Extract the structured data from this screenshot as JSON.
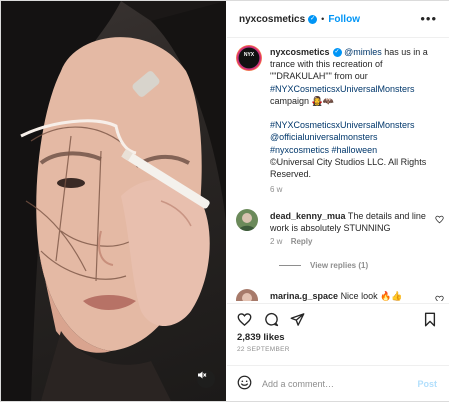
{
  "header": {
    "username": "nyxcosmetics",
    "follow_label": "Follow",
    "separator": "•",
    "more_label": "•••"
  },
  "avatar_logo": "NYX",
  "caption": {
    "username": "nyxcosmetics",
    "mention": "@mimles",
    "text_1": " has us in a trance with this recreation of \"\"DRAKULAH\"\" from our ",
    "hashtag_1": "#NYXCosmeticsxUniversalMonsters",
    "text_2": " campaign 🧛‍♀️🦇",
    "hashtag_2": "#NYXCosmeticsxUniversalMonsters",
    "mention_2": "@officialuniversalmonsters",
    "hashtag_3": "#nyxcosmetics",
    "hashtag_4": "#halloween",
    "text_3": "©Universal City Studios LLC. All Rights Reserved.",
    "age": "6 w"
  },
  "comments": [
    {
      "username": "dead_kenny_mua",
      "text": "The details and line work is absolutely STUNNING",
      "age": "2 w",
      "reply_label": "Reply",
      "view_replies": "View replies (1)"
    },
    {
      "username": "marina.g_space",
      "text": "Nice look 🔥👍"
    }
  ],
  "likes": "2,839 likes",
  "date": "22 SEPTEMBER",
  "add_comment": {
    "placeholder": "Add a comment…",
    "post_label": "Post"
  },
  "colors": {
    "accent": "#0095f6",
    "link": "#00376b",
    "muted": "#8e8e8e",
    "post_disabled": "#b2dffc"
  },
  "icons": [
    "verified-badge-icon",
    "more-options-icon",
    "heart-icon",
    "comment-icon",
    "share-icon",
    "bookmark-icon",
    "emoji-icon",
    "mute-icon"
  ]
}
